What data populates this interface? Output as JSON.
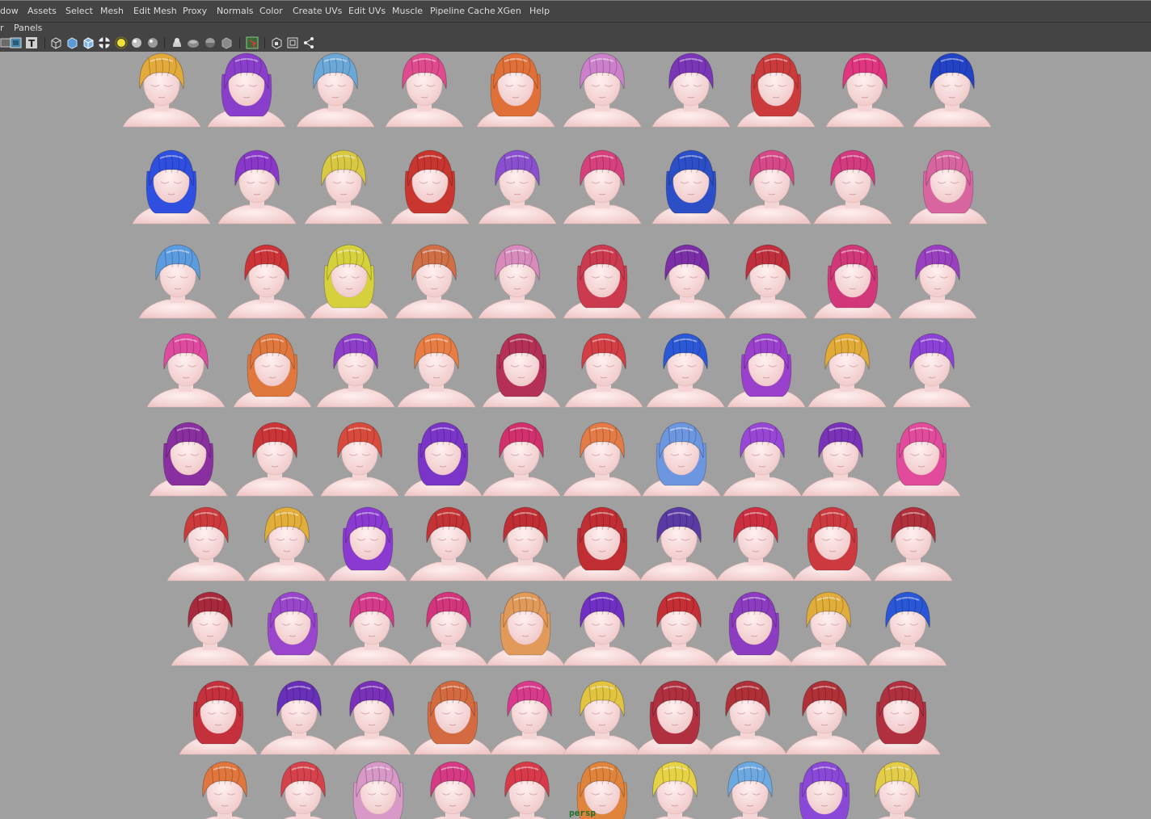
{
  "menu": {
    "items": [
      "dow",
      "Assets",
      "Select",
      "Mesh",
      "Edit Mesh",
      "Proxy",
      "Normals",
      "Color",
      "Create UVs",
      "Edit UVs",
      "Muscle",
      "Pipeline Cache",
      "XGen",
      "Help"
    ]
  },
  "panel_menu": {
    "arrow": "r",
    "label": "Panels"
  },
  "toolbar": {
    "icons": [
      "wireframe-shaded-icon",
      "texture-icon",
      "text-icon",
      "wireframe-cube-icon",
      "smooth-shade-icon",
      "shaded-wire-icon",
      "checker-icon",
      "light-bulb-icon",
      "default-light-icon",
      "shadow-icon",
      "bust-icon",
      "sphere-icon",
      "half-sphere-icon",
      "cube-dark-icon",
      "select-highlight-icon",
      "isolate-icon",
      "frame-icon",
      "share-icon"
    ]
  },
  "viewport": {
    "camera_label": "persp",
    "background": "#a0a0a0",
    "models": [
      {
        "row": 0,
        "colors": [
          "#e3a93a",
          "#8a3fcc",
          "#6ba8d8",
          "#e04a8f",
          "#e07038",
          "#cc80cc",
          "#7b36b8",
          "#cc3b3b",
          "#e0357f",
          "#2343c6"
        ]
      },
      {
        "row": 1,
        "colors": [
          "#2f4fe0",
          "#8a38c9",
          "#d8c842",
          "#c8362f",
          "#8a4fcf",
          "#d6407d",
          "#2c4fc8",
          "#d64888",
          "#d43a80",
          "#d965a0"
        ]
      },
      {
        "row": 2,
        "colors": [
          "#5b9be0",
          "#cc3438",
          "#d6d03c",
          "#d06e45",
          "#d98abd",
          "#cc3a50",
          "#7b2ea5",
          "#c0303c",
          "#d2377a",
          "#9a3fc0"
        ]
      },
      {
        "row": 3,
        "colors": [
          "#de4b9e",
          "#e0773d",
          "#8f3ec9",
          "#e87e44",
          "#b43056",
          "#d23e44",
          "#2b58d6",
          "#9a40cc",
          "#e2aa36",
          "#8c42d6"
        ]
      },
      {
        "row": 4,
        "colors": [
          "#8a2fa0",
          "#cc3538",
          "#d84a3c",
          "#7a35c8",
          "#d1306c",
          "#e47a45",
          "#6c96e0",
          "#9846d6",
          "#7a32b8",
          "#e24a9c"
        ]
      },
      {
        "row": 5,
        "colors": [
          "#cc3a3c",
          "#e3ad3a",
          "#8b3ad1",
          "#c33234",
          "#c02e34",
          "#c02e34",
          "#5a3aa5",
          "#cc3040",
          "#cc3a40",
          "#b0303c"
        ]
      },
      {
        "row": 6,
        "colors": [
          "#a8283c",
          "#9a46cc",
          "#d63a8a",
          "#d2357c",
          "#e29a5a",
          "#7030c4",
          "#c42e34",
          "#8c3cc0",
          "#e0ac3a",
          "#2a56d8"
        ]
      },
      {
        "row": 7,
        "colors": [
          "#c4303c",
          "#6830b8",
          "#7a30b8",
          "#d46a40",
          "#d83a8c",
          "#e2c440",
          "#b03040",
          "#b03038",
          "#b03038",
          "#b03040"
        ]
      },
      {
        "row": 8,
        "colors": [
          "#e0763c",
          "#d6424c",
          "#d898c8",
          "#d63a84",
          "#d83a4a",
          "#e0843c",
          "#e6d244",
          "#6ea8e0",
          "#8a48d8",
          "#e2cc48"
        ]
      }
    ]
  }
}
